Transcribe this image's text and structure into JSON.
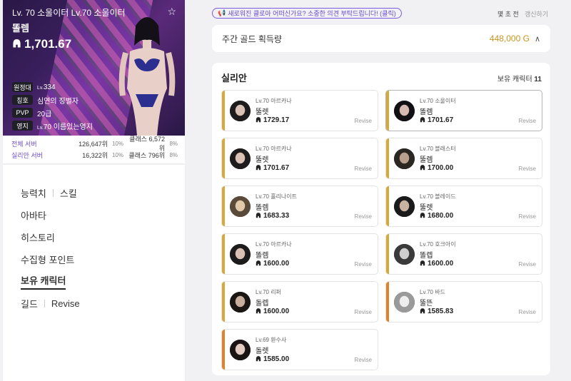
{
  "profile": {
    "level_class": "Lv. 70 소울이터 Lv.70 소울이터",
    "name": "똘렘",
    "item_level": "1,701.67",
    "infos": [
      {
        "tag": "원정대",
        "pre": "Lv.",
        "value": "334"
      },
      {
        "tag": "칭호",
        "pre": "",
        "value": "심연의 징벌자"
      },
      {
        "tag": "PVP",
        "pre": "",
        "value": "20급"
      },
      {
        "tag": "영지",
        "pre": "Lv.",
        "value": "70 이름있는영지"
      }
    ]
  },
  "ranks": [
    {
      "label": "전체 서버",
      "rank": "126,647위",
      "pct": "10%",
      "class_rank": "클래스 6,572위",
      "class_pct": "8%"
    },
    {
      "label": "실리안 서버",
      "rank": "16,322위",
      "pct": "10%",
      "class_rank": "클래스 796위",
      "class_pct": "8%"
    }
  ],
  "menu": {
    "ability": "능력치",
    "skill": "스킬",
    "avatar": "아바타",
    "history": "히스토리",
    "collect": "수집형 포인트",
    "characters": "보유 캐릭터",
    "guild": "길드",
    "revise": "Revise"
  },
  "notice": "새로워진 클로아 어떠신가요? 소중한 의견 부탁드립니다! (클릭)",
  "updated": "몇 초 전",
  "refresh_label": "갱신하기",
  "gold": {
    "label": "주간 골드 획득량",
    "value": "448,000 G"
  },
  "server": "실리안",
  "char_count_label": "보유 캐릭터",
  "char_count": "11",
  "revise_label": "Revise",
  "colors": {
    "accent_gold": "#d6a93a",
    "accent_orange": "#e0812c",
    "brand_purple": "#6a4acb"
  },
  "characters": [
    {
      "level_class": "Lv.70 아르카나",
      "name": "뚤렛",
      "ilvl": "1729.17",
      "bar": "#d6a93a",
      "selected": false
    },
    {
      "level_class": "Lv.70 소울이터",
      "name": "똘렘",
      "ilvl": "1701.67",
      "bar": "#d6a93a",
      "selected": true
    },
    {
      "level_class": "Lv.70 아르카나",
      "name": "뚤렛",
      "ilvl": "1701.67",
      "bar": "#d6a93a",
      "selected": false
    },
    {
      "level_class": "Lv.70 블래스터",
      "name": "뚤렘",
      "ilvl": "1700.00",
      "bar": "#d6a93a",
      "selected": false
    },
    {
      "level_class": "Lv.70 홀리나이트",
      "name": "똘렘",
      "ilvl": "1683.33",
      "bar": "#d6a93a",
      "selected": false
    },
    {
      "level_class": "Lv.70 블레이드",
      "name": "뚤렛",
      "ilvl": "1680.00",
      "bar": "#d6a93a",
      "selected": false
    },
    {
      "level_class": "Lv.70 아르카나",
      "name": "똘렘",
      "ilvl": "1600.00",
      "bar": "#d6a93a",
      "selected": false
    },
    {
      "level_class": "Lv.70 호크아이",
      "name": "똘렙",
      "ilvl": "1600.00",
      "bar": "#d6a93a",
      "selected": false
    },
    {
      "level_class": "Lv.70 리퍼",
      "name": "돌렙",
      "ilvl": "1600.00",
      "bar": "#d6a93a",
      "selected": false
    },
    {
      "level_class": "Lv.70 바드",
      "name": "뚤뜬",
      "ilvl": "1585.83",
      "bar": "#e0812c",
      "selected": false
    },
    {
      "level_class": "Lv.69 환수사",
      "name": "돌렛",
      "ilvl": "1585.00",
      "bar": "#e0812c",
      "selected": false
    }
  ]
}
